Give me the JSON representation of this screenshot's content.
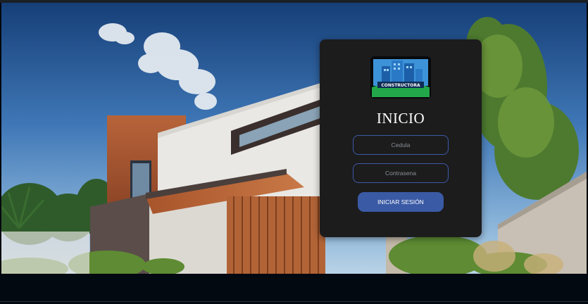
{
  "login": {
    "logo_text": "CONSTRUCTORA",
    "title": "INICIO",
    "cedula_placeholder": "Cedula",
    "password_placeholder": "Contrasena",
    "submit_label": "INICIAR SESIÓN"
  },
  "colors": {
    "card_background": "#1c1c1d",
    "field_border": "#3c5aa6",
    "button_background": "#3a5aa5",
    "page_background": "#02070d"
  }
}
